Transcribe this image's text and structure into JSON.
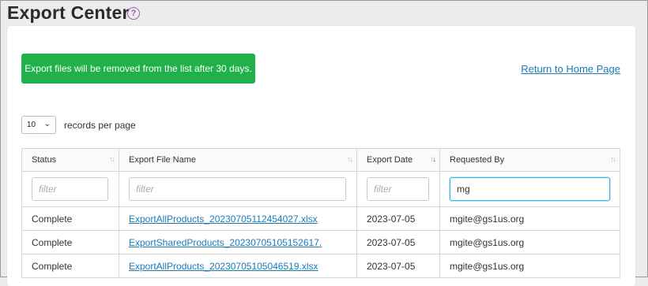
{
  "page": {
    "title": "Export Center",
    "help_icon": "?"
  },
  "notice": {
    "text": "Export files will be removed from the list after 30 days."
  },
  "links": {
    "return_home": "Return to Home Page"
  },
  "pagination": {
    "records_per_page_value": "10",
    "records_per_page_label": "records per page"
  },
  "table": {
    "columns": [
      "Status",
      "Export File Name",
      "Export Date",
      "Requested By"
    ],
    "filters": [
      {
        "placeholder": "filter",
        "value": ""
      },
      {
        "placeholder": "filter",
        "value": ""
      },
      {
        "placeholder": "filter",
        "value": ""
      },
      {
        "placeholder": "filter",
        "value": "mg"
      }
    ],
    "rows": [
      {
        "status": "Complete",
        "file": "ExportAllProducts_20230705112454027.xlsx",
        "date": "2023-07-05",
        "by": "mgite@gs1us.org"
      },
      {
        "status": "Complete",
        "file": "ExportSharedProducts_20230705105152617.",
        "date": "2023-07-05",
        "by": "mgite@gs1us.org"
      },
      {
        "status": "Complete",
        "file": "ExportAllProducts_20230705105046519.xlsx",
        "date": "2023-07-05",
        "by": "mgite@gs1us.org"
      }
    ]
  },
  "colors": {
    "notice_bg": "#20b14a",
    "link": "#1a7ab8",
    "sort_active": "#8e44ad",
    "focus_border": "#41b6e6"
  },
  "icons": {
    "help": "question-circle-icon",
    "dropdown": "chevron-down-icon",
    "sort": "sort-arrows-icon"
  }
}
